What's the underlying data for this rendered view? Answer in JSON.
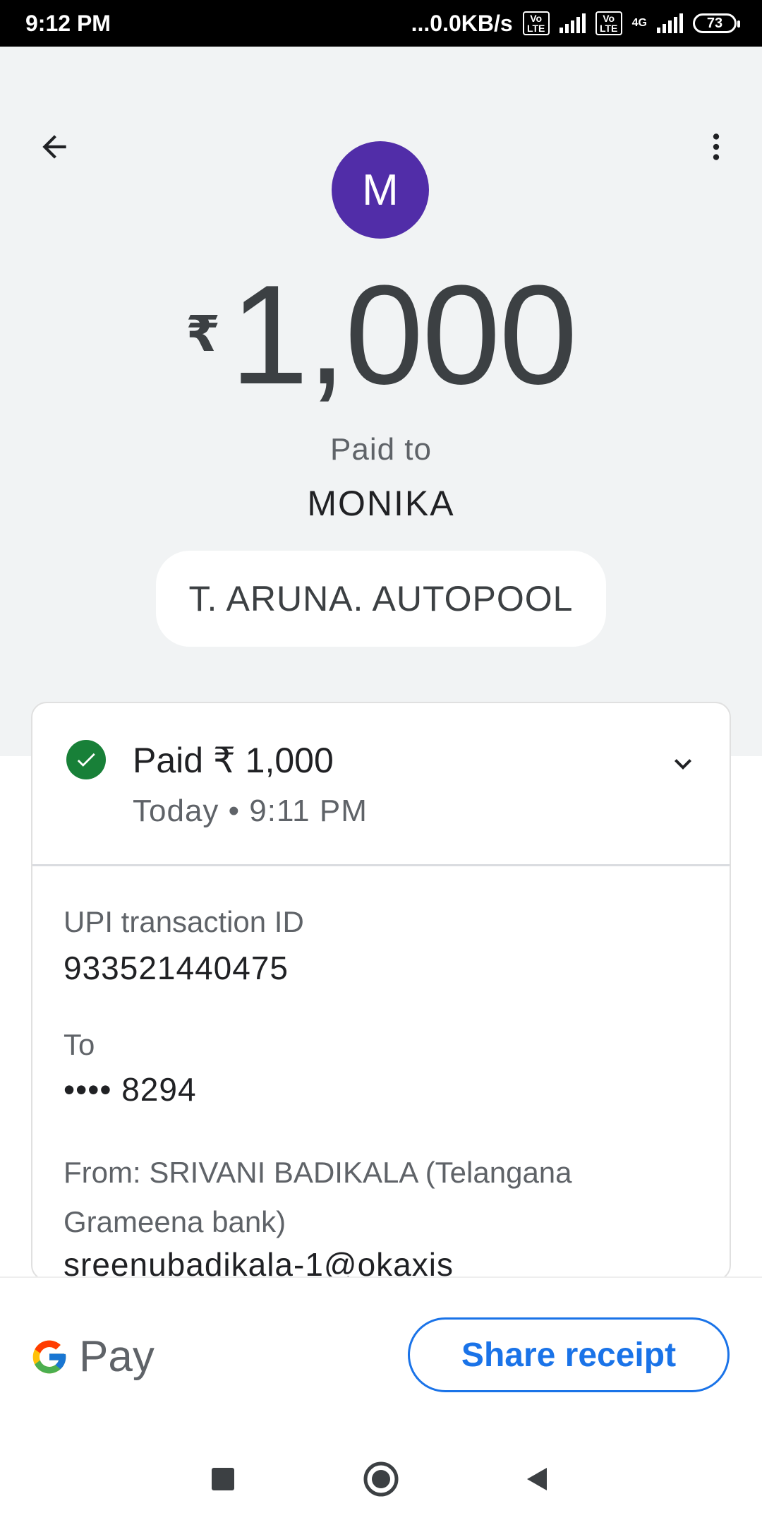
{
  "status_bar": {
    "time": "9:12 PM",
    "network_speed": "...0.0KB/s",
    "volte_1": "Vo LTE",
    "volte_2": "Vo LTE",
    "network_type": "4G",
    "battery": "73"
  },
  "header": {
    "back_icon": "arrow-back-icon",
    "more_icon": "more-vert-icon"
  },
  "payee": {
    "avatar_letter": "M",
    "avatar_color": "#512da8",
    "currency_symbol": "₹",
    "amount": "1,000",
    "paid_to_label": "Paid to",
    "name": "MONIKA",
    "note": "T. ARUNA. AUTOPOOL"
  },
  "transaction": {
    "status_icon": "check-circle-icon",
    "status_color": "#188038",
    "status_text": "Paid ₹ 1,000",
    "time_text": "Today • 9:11 PM",
    "expand_icon": "chevron-down-icon",
    "details": {
      "upi_label": "UPI transaction ID",
      "upi_value": "933521440475",
      "to_label": "To",
      "to_value": "•••• 8294",
      "from_label": "From: SRIVANI BADIKALA (Telangana Grameena bank)",
      "from_value": "sreenubadikala-1@okaxis"
    }
  },
  "footer": {
    "logo_text": "Pay",
    "share_label": "Share receipt",
    "accent_color": "#1a73e8"
  },
  "nav": {
    "recents_icon": "square-recents-icon",
    "home_icon": "circle-home-icon",
    "back_icon": "triangle-back-icon"
  }
}
